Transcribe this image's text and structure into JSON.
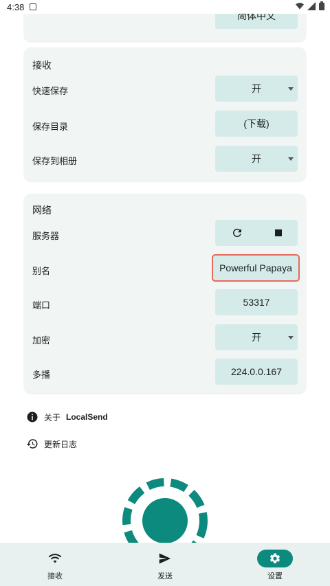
{
  "status_bar": {
    "time": "4:38"
  },
  "language_card": {
    "value": "简体中文"
  },
  "receive_card": {
    "title": "接收",
    "rows": [
      {
        "label": "快速保存",
        "value": "开"
      },
      {
        "label": "保存目录",
        "value": "(下载)"
      },
      {
        "label": "保存到相册",
        "value": "开"
      }
    ]
  },
  "network_card": {
    "title": "网络",
    "server_label": "服务器",
    "alias_label": "别名",
    "alias_value": "Powerful Papaya",
    "port_label": "端口",
    "port_value": "53317",
    "encryption_label": "加密",
    "encryption_value": "开",
    "multicast_label": "多播",
    "multicast_value": "224.0.0.167"
  },
  "links": {
    "about": "关于",
    "about_app": "LocalSend",
    "changelog": "更新日志"
  },
  "bottom_nav": [
    {
      "label": "接收",
      "icon": "wifi-icon"
    },
    {
      "label": "发送",
      "icon": "send-icon"
    },
    {
      "label": "设置",
      "icon": "gear-icon",
      "active": true
    }
  ],
  "colors": {
    "accent": "#0b8a7d",
    "card_bg": "#f1f6f5",
    "control_bg": "#d5ebe9",
    "highlight": "#e7695a"
  }
}
